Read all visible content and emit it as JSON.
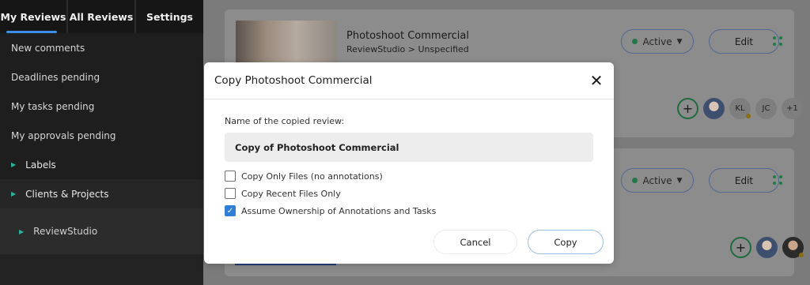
{
  "sidebar": {
    "tabs": [
      "My Reviews",
      "All Reviews",
      "Settings"
    ],
    "items": [
      "New comments",
      "Deadlines pending",
      "My tasks pending",
      "My approvals pending"
    ],
    "labels_section": "Labels",
    "clients_section": "Clients & Projects",
    "sub_item": "ReviewStudio"
  },
  "cards": [
    {
      "title": "Photoshoot Commercial",
      "subtitle": "ReviewStudio > Unspecified",
      "status": "Active",
      "edit_label": "Edit",
      "avatars": [
        "KL",
        "JC",
        "+1"
      ]
    },
    {
      "status": "Active",
      "edit_label": "Edit"
    }
  ],
  "modal": {
    "title": "Copy Photoshoot Commercial",
    "field_label": "Name of the copied review:",
    "name_value": "Copy of Photoshoot Commercial",
    "options": [
      {
        "label": "Copy Only Files (no annotations)",
        "checked": false
      },
      {
        "label": "Copy Recent Files Only",
        "checked": false
      },
      {
        "label": "Assume Ownership of Annotations and Tasks",
        "checked": true
      }
    ],
    "cancel_label": "Cancel",
    "copy_label": "Copy"
  },
  "colors": {
    "accent": "#3a8ee6",
    "status_green": "#2e9e5b",
    "sidebar_bg": "#1e1e1e"
  }
}
